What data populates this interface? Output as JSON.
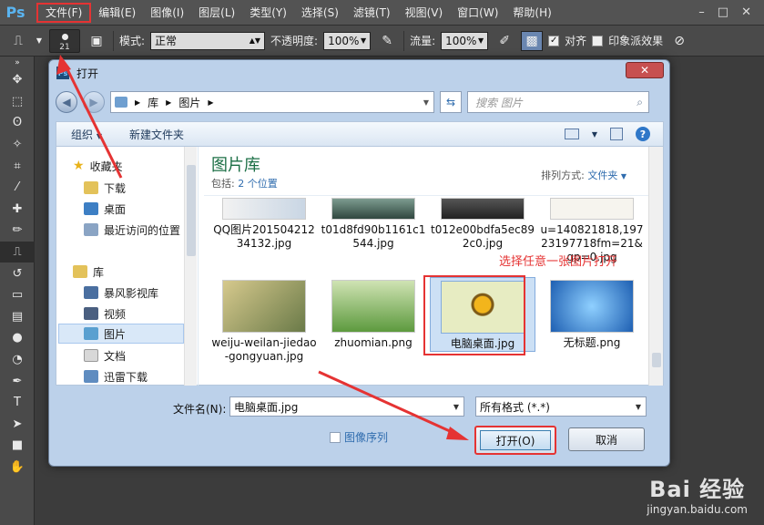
{
  "app": {
    "logo": "Ps",
    "menus": [
      "文件(F)",
      "编辑(E)",
      "图像(I)",
      "图层(L)",
      "类型(Y)",
      "选择(S)",
      "滤镜(T)",
      "视图(V)",
      "窗口(W)",
      "帮助(H)"
    ],
    "window_controls": [
      "–",
      "□",
      "✕"
    ]
  },
  "options": {
    "brush_size": "21",
    "mode_label": "模式:",
    "mode_value": "正常",
    "opacity_label": "不透明度:",
    "opacity_value": "100%",
    "flow_label": "流量:",
    "flow_value": "100%",
    "align_label": "对齐",
    "impressionist_label": "印象派效果"
  },
  "dialog": {
    "title": "打开",
    "close": "✕",
    "breadcrumb": [
      "库",
      "图片"
    ],
    "search_placeholder": "搜索 图片",
    "organize": "组织",
    "new_folder": "新建文件夹",
    "help": "?",
    "nav": {
      "favorites": "收藏夹",
      "items": [
        "下载",
        "桌面",
        "最近访问的位置"
      ],
      "library": "库",
      "lib_items": [
        "暴风影视库",
        "视频",
        "图片",
        "文档",
        "迅雷下载"
      ]
    },
    "library_title": "图片库",
    "includes_label": "包括:",
    "includes_value": "2 个位置",
    "sort_label": "排列方式:",
    "sort_value": "文件夹",
    "files": [
      {
        "name": "QQ图片20150421234132.jpg",
        "selected": false
      },
      {
        "name": "t01d8fd90b1161c1544.jpg",
        "selected": false
      },
      {
        "name": "t012e00bdfa5ec892c0.jpg",
        "selected": false
      },
      {
        "name": "u=140821818,19723197718fm=21&gp=0.jpg",
        "selected": false
      },
      {
        "name": "weiju-weilan-jiedao-gongyuan.jpg",
        "selected": false
      },
      {
        "name": "zhuomian.png",
        "selected": false
      },
      {
        "name": "电脑桌面.jpg",
        "selected": true
      },
      {
        "name": "无标题.png",
        "selected": false
      }
    ],
    "filename_label": "文件名(N):",
    "filename_value": "电脑桌面.jpg",
    "filetype_value": "所有格式 (*.*)",
    "image_sequence": "图像序列",
    "open_button": "打开(O)",
    "cancel_button": "取消"
  },
  "annotation": "选择任意一张图片打开",
  "watermark": {
    "logo": "Bai 经验",
    "url": "jingyan.baidu.com"
  },
  "colors": {
    "annotation_red": "#e53333",
    "library_green": "#1b6f45",
    "link_blue": "#2f6cae"
  }
}
